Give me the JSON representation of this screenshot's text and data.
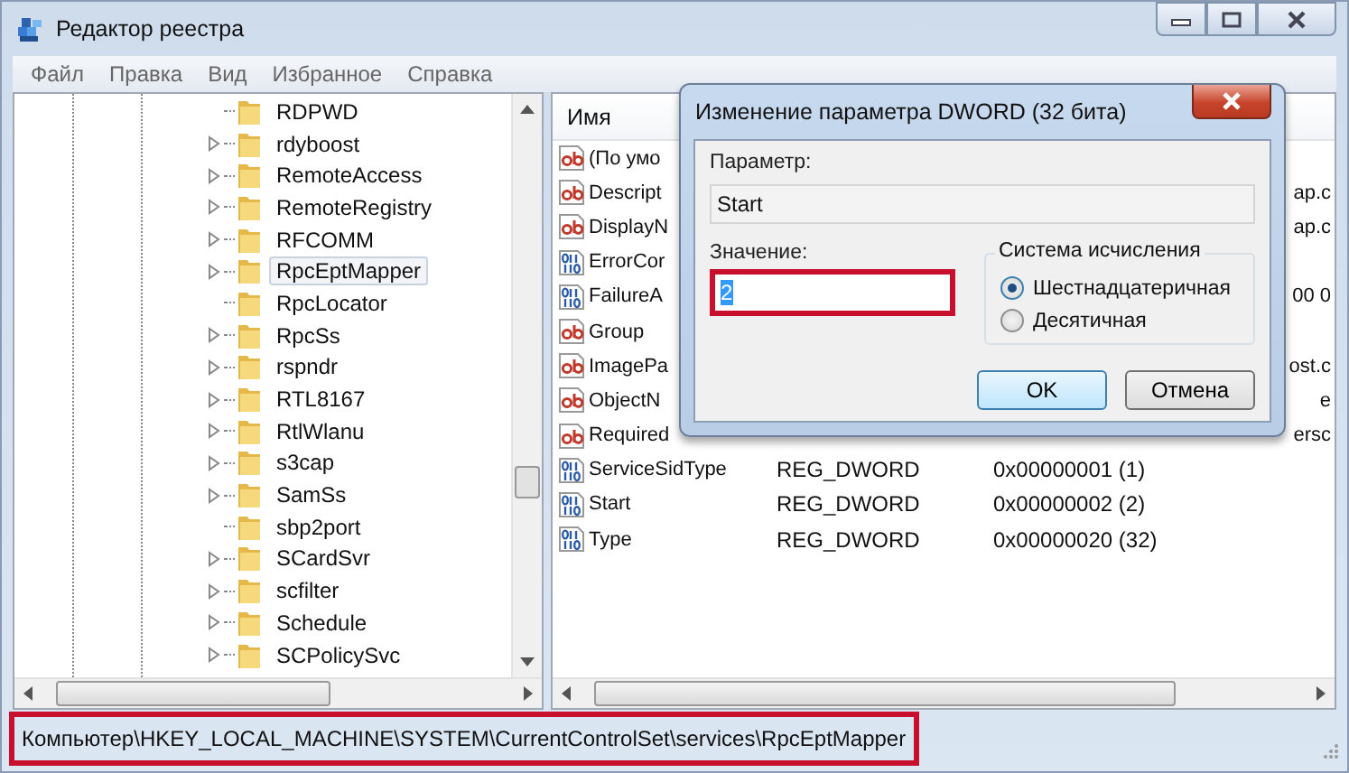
{
  "window": {
    "title": "Редактор реестра"
  },
  "menu": [
    "Файл",
    "Правка",
    "Вид",
    "Избранное",
    "Справка"
  ],
  "tree": {
    "items": [
      {
        "label": "RDPWD",
        "expandable": false,
        "selected": false
      },
      {
        "label": "rdyboost",
        "expandable": true,
        "selected": false
      },
      {
        "label": "RemoteAccess",
        "expandable": true,
        "selected": false
      },
      {
        "label": "RemoteRegistry",
        "expandable": true,
        "selected": false
      },
      {
        "label": "RFCOMM",
        "expandable": true,
        "selected": false
      },
      {
        "label": "RpcEptMapper",
        "expandable": true,
        "selected": true
      },
      {
        "label": "RpcLocator",
        "expandable": false,
        "selected": false
      },
      {
        "label": "RpcSs",
        "expandable": true,
        "selected": false
      },
      {
        "label": "rspndr",
        "expandable": true,
        "selected": false
      },
      {
        "label": "RTL8167",
        "expandable": true,
        "selected": false
      },
      {
        "label": "RtlWlanu",
        "expandable": true,
        "selected": false
      },
      {
        "label": "s3cap",
        "expandable": true,
        "selected": false
      },
      {
        "label": "SamSs",
        "expandable": true,
        "selected": false
      },
      {
        "label": "sbp2port",
        "expandable": false,
        "selected": false
      },
      {
        "label": "SCardSvr",
        "expandable": true,
        "selected": false
      },
      {
        "label": "scfilter",
        "expandable": true,
        "selected": false
      },
      {
        "label": "Schedule",
        "expandable": true,
        "selected": false
      },
      {
        "label": "SCPolicySvc",
        "expandable": true,
        "selected": false
      }
    ]
  },
  "values": {
    "columns": [
      "Имя"
    ],
    "rows": [
      {
        "kind": "string",
        "name": "(По умо"
      },
      {
        "kind": "string",
        "name": "Descript",
        "data": "ap.c"
      },
      {
        "kind": "string",
        "name": "DisplayN",
        "data": "ap.c"
      },
      {
        "kind": "dword",
        "name": "ErrorCor"
      },
      {
        "kind": "dword",
        "name": "FailureA",
        "data": "00 0"
      },
      {
        "kind": "string",
        "name": "Group"
      },
      {
        "kind": "string",
        "name": "ImagePa",
        "data": "ost.c"
      },
      {
        "kind": "string",
        "name": "ObjectN",
        "data": "e"
      },
      {
        "kind": "string",
        "name": "Required",
        "data": "ersc"
      },
      {
        "kind": "dword",
        "name": "ServiceSidType",
        "type": "REG_DWORD",
        "data": "0x00000001 (1)"
      },
      {
        "kind": "dword",
        "name": "Start",
        "type": "REG_DWORD",
        "data": "0x00000002 (2)"
      },
      {
        "kind": "dword",
        "name": "Type",
        "type": "REG_DWORD",
        "data": "0x00000020 (32)"
      }
    ]
  },
  "status_bar": {
    "path": "Компьютер\\HKEY_LOCAL_MACHINE\\SYSTEM\\CurrentControlSet\\services\\RpcEptMapper",
    "highlighted": true
  },
  "dialog": {
    "title": "Изменение параметра DWORD (32 бита)",
    "param_label": "Параметр:",
    "param_value": "Start",
    "value_label": "Значение:",
    "value": "2",
    "value_highlighted": true,
    "base_group": "Система исчисления",
    "bases": [
      {
        "label": "Шестнадцатеричная",
        "selected": true
      },
      {
        "label": "Десятичная",
        "selected": false
      }
    ],
    "buttons": [
      {
        "label": "OK",
        "default": true
      },
      {
        "label": "Отмена",
        "default": false
      }
    ]
  }
}
